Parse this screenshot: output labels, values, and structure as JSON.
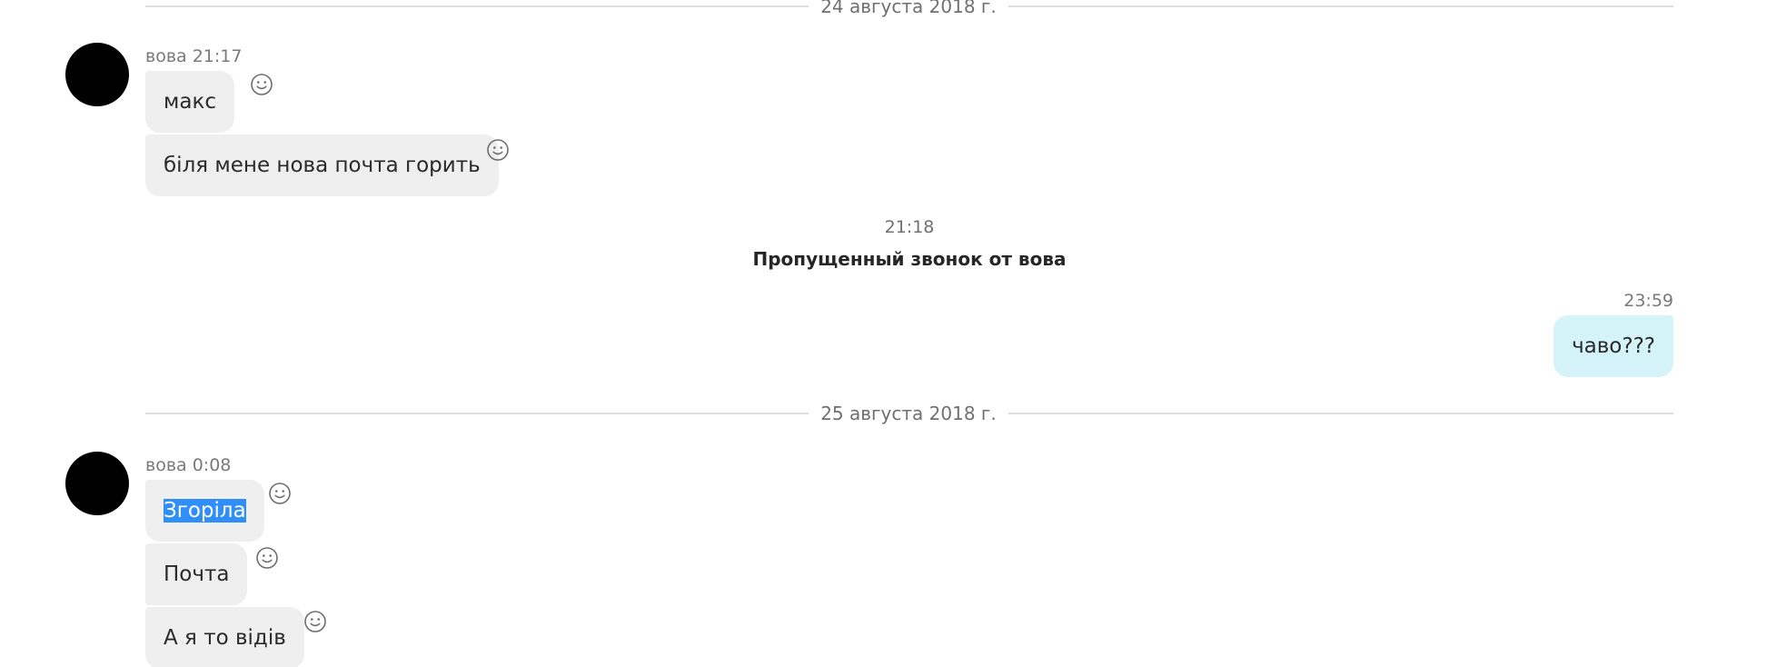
{
  "separators": {
    "date1": "24 августа 2018 г.",
    "date2": "25 августа 2018 г."
  },
  "group1": {
    "sender": "вова 21:17",
    "messages": [
      "макс",
      "біля мене нова почта горить"
    ]
  },
  "call": {
    "time": "21:18",
    "text": "Пропущенный звонок от вова"
  },
  "outgoing": {
    "time": "23:59",
    "text": "чаво???"
  },
  "group2": {
    "sender": "вова 0:08",
    "messages": [
      "Згоріла",
      "Почта",
      "А я то відів"
    ]
  },
  "colors": {
    "incoming_bubble": "#efefef",
    "outgoing_bubble": "#d4f4fa",
    "selection": "#2f8ef8"
  },
  "icons": {
    "avatar": "avatar",
    "reaction": "smiley-icon"
  }
}
